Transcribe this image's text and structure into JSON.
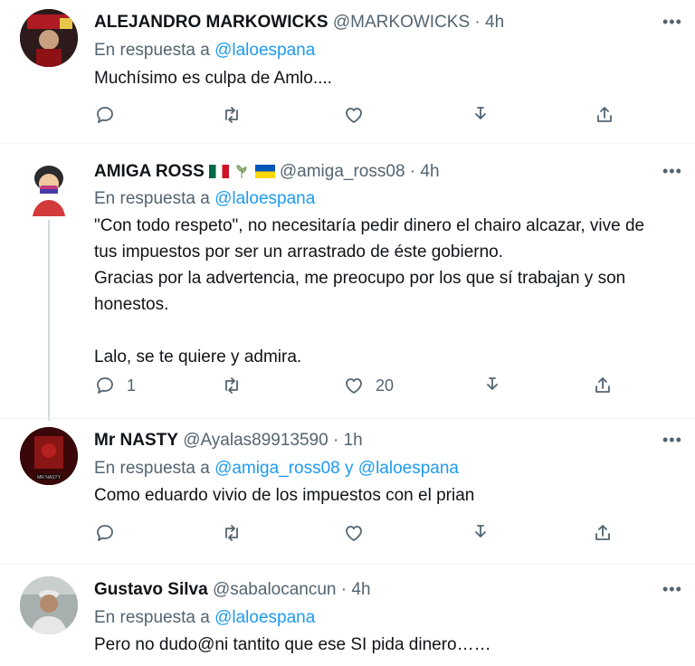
{
  "tweets": [
    {
      "name": "ALEJANDRO MARKOWICKS",
      "handle": "@MARKOWICKS",
      "dot": "·",
      "time": "4h",
      "reply_prefix": "En respuesta a",
      "reply_to": "@laloespana",
      "text": [
        "Muchísimo es culpa de Amlo...."
      ],
      "replies": "",
      "retweets": "",
      "likes": ""
    },
    {
      "name": "AMIGA ROSS",
      "handle": "@amiga_ross08",
      "dot": "·",
      "time": "4h",
      "reply_prefix": "En respuesta a",
      "reply_to": "@laloespana",
      "text": [
        "\"Con todo respeto\", no necesitaría pedir dinero el chairo alcazar, vive de",
        "tus impuestos por ser un arrastrado de éste gobierno.",
        "Gracias por la advertencia, me preocupo por los que sí trabajan y son",
        "honestos.",
        "",
        "Lalo, se te quiere y admira."
      ],
      "replies": "1",
      "retweets": "",
      "likes": "20"
    },
    {
      "name": "Mr NASTY",
      "handle": "@Ayalas89913590",
      "dot": "·",
      "time": "1h",
      "reply_prefix": "En respuesta a",
      "reply_to": "@amiga_ross08 y @laloespana",
      "text": [
        "Como eduardo vivio de los impuestos con el prian"
      ],
      "replies": "",
      "retweets": "",
      "likes": ""
    },
    {
      "name": "Gustavo Silva",
      "handle": "@sabalocancun",
      "dot": "·",
      "time": "4h",
      "reply_prefix": "En respuesta a",
      "reply_to": "@laloespana",
      "text": [
        "Pero no dudo@ni tantito que ese SI pida dinero……"
      ],
      "replies": "",
      "retweets": "",
      "likes": ""
    }
  ],
  "more_label": "•••",
  "avatar_caption_3": "MR NASTY",
  "colors": {
    "accent": "#1d9bf0",
    "secondary": "#536471",
    "text": "#0f1419"
  },
  "icons": [
    "reply-icon",
    "retweet-icon",
    "like-icon",
    "download-icon",
    "share-icon"
  ]
}
